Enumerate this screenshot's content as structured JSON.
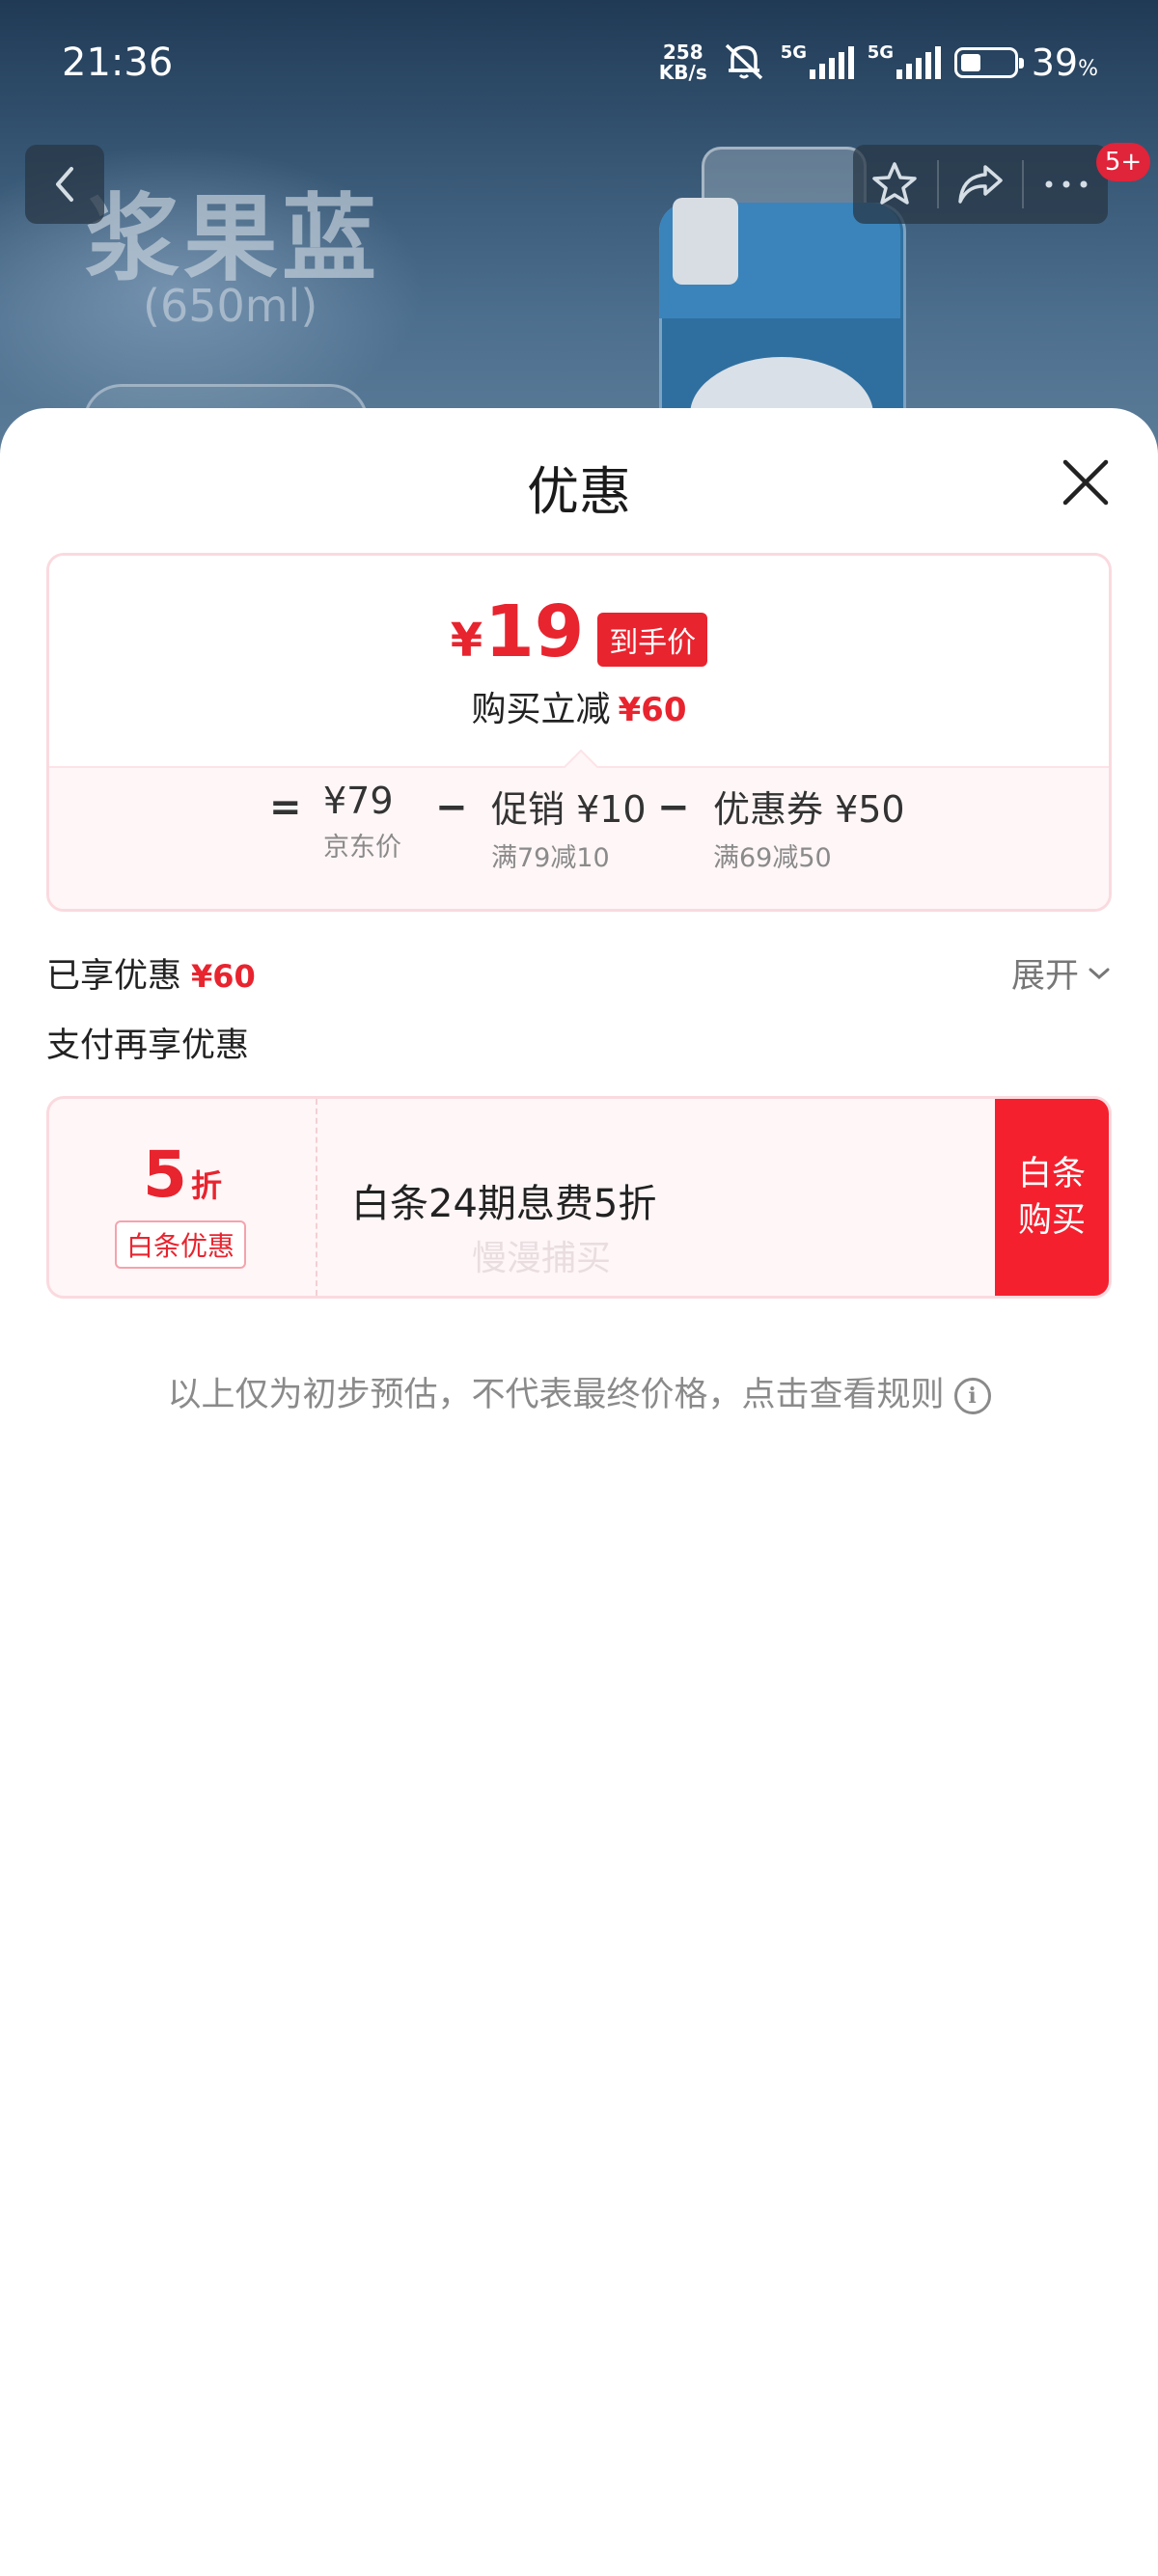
{
  "status_bar": {
    "time": "21:36",
    "net_speed_value": "258",
    "net_speed_unit": "KB/s",
    "signal1_label": "5G",
    "signal2_label": "5G",
    "battery_percent": "39",
    "battery_unit": "%",
    "battery_level": 0.39
  },
  "product_bg": {
    "title": "浆果蓝",
    "subtitle": "(650ml)",
    "message_badge": "5+"
  },
  "sheet": {
    "title": "优惠"
  },
  "price_card": {
    "currency": "¥",
    "final_price": "19",
    "final_tag": "到手价",
    "reduce_label": "购买立减",
    "reduce_value": "¥60",
    "formula": {
      "eq": "=",
      "minus": "−",
      "base_value": "¥79",
      "base_label": "京东价",
      "promo_value": "促销 ¥10",
      "promo_label": "满79减10",
      "coupon_value": "优惠券 ¥50",
      "coupon_label": "满69减50"
    }
  },
  "enjoyed": {
    "label": "已享优惠",
    "value": "¥60",
    "expand": "展开"
  },
  "pay_more": {
    "label": "支付再享优惠"
  },
  "baitiao": {
    "discount_number": "5",
    "discount_unit": "折",
    "tag": "白条优惠",
    "description": "白条24期息费5折",
    "watermark": "慢漫捕买",
    "buy_line1": "白条",
    "buy_line2": "购买"
  },
  "disclaimer": "以上仅为初步预估，不代表最终价格，点击查看规则",
  "colors": {
    "accent_red": "#e8242f",
    "buy_red": "#f5202e"
  }
}
